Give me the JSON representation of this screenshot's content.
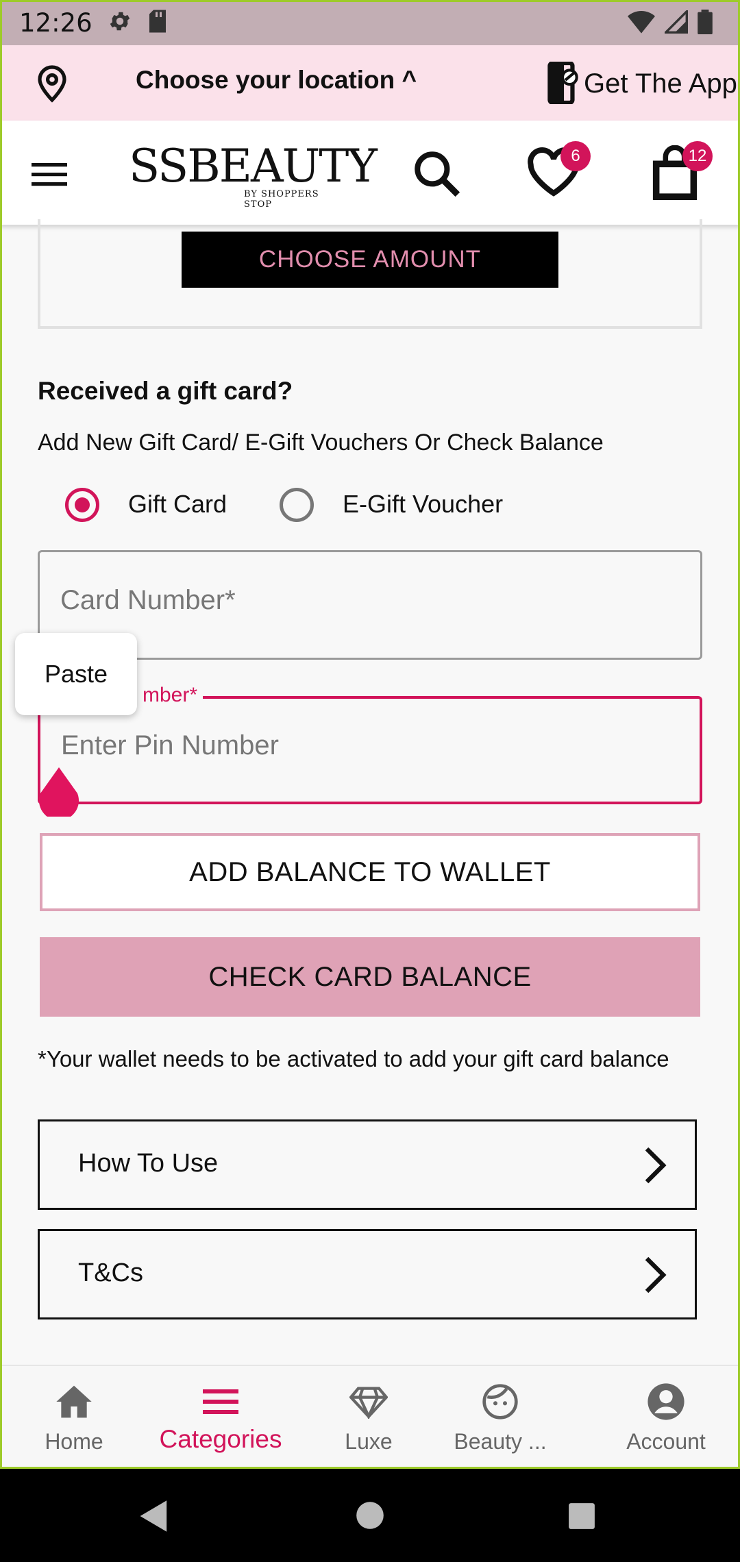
{
  "status_bar": {
    "time": "12:26"
  },
  "location": {
    "label": "Choose your location ^",
    "get_app": "Get The App"
  },
  "header": {
    "logo_main": "SSBEAUTY",
    "logo_sub": "BY SHOPPERS STOP",
    "wishlist_count": "6",
    "cart_count": "12"
  },
  "amount": {
    "choose_amount_label": "CHOOSE AMOUNT"
  },
  "gift_card": {
    "title": "Received a gift card?",
    "subtitle": "Add New Gift Card/ E-Gift Vouchers Or Check Balance",
    "radio_gift_card": "Gift Card",
    "radio_e_gift_voucher": "E-Gift Voucher",
    "card_number_placeholder": "Card Number*",
    "pin_label": "mber*",
    "pin_placeholder": "Enter Pin Number",
    "paste_label": "Paste",
    "add_balance_label": "ADD BALANCE TO WALLET",
    "check_balance_label": "CHECK CARD BALANCE",
    "wallet_note": "*Your wallet needs to be activated to add your gift card balance"
  },
  "accordions": [
    {
      "label": "How To Use"
    },
    {
      "label": "T&Cs"
    }
  ],
  "bottom_nav": [
    {
      "label": "Home",
      "icon": "home-icon"
    },
    {
      "label": "Categories",
      "icon": "menu-icon",
      "active": true
    },
    {
      "label": "Luxe",
      "icon": "diamond-icon"
    },
    {
      "label": "Beauty ...",
      "icon": "face-icon"
    },
    {
      "label": "Account",
      "icon": "account-icon"
    }
  ],
  "colors": {
    "accent": "#d2145a",
    "check_button": "#dfa2b6",
    "location_bg": "#fbe1ea"
  }
}
